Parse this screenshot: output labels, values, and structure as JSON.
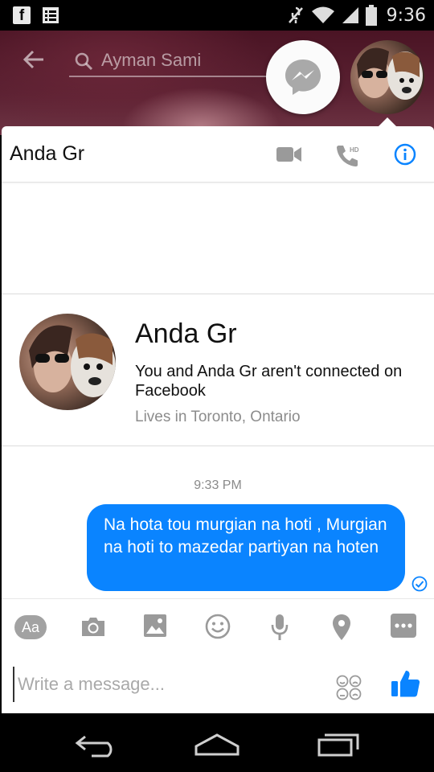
{
  "status_bar": {
    "time": "9:36",
    "fb_glyph": "f"
  },
  "search": {
    "placeholder": "Ayman Sami"
  },
  "chat": {
    "title": "Anda Gr"
  },
  "profile": {
    "name": "Anda Gr",
    "connection": "You and Anda Gr aren't connected on Facebook",
    "location": "Lives in Toronto, Ontario"
  },
  "conversation": {
    "timestamp": "9:33 PM",
    "messages": [
      {
        "text": "Na hota tou murgian na hoti , Murgian na hoti to mazedar partiyan na hoten",
        "sender": "me"
      }
    ]
  },
  "composer": {
    "aa_label": "Aa",
    "placeholder": "Write a message..."
  },
  "icons": [
    "facebook-icon",
    "notes-icon",
    "mute-icon",
    "wifi-icon",
    "signal-icon",
    "battery-icon",
    "back-arrow-icon",
    "search-icon",
    "messenger-icon",
    "video-call-icon",
    "hd-call-icon",
    "info-icon",
    "seen-check-icon",
    "camera-icon",
    "gallery-icon",
    "emoji-icon",
    "microphone-icon",
    "location-icon",
    "more-icon",
    "stickers-icon",
    "like-icon",
    "nav-back-icon",
    "nav-home-icon",
    "nav-recents-icon"
  ],
  "colors": {
    "accent": "#0a84ff",
    "icon_gray": "#9a9a9a",
    "background_tint": "#5b2132"
  }
}
